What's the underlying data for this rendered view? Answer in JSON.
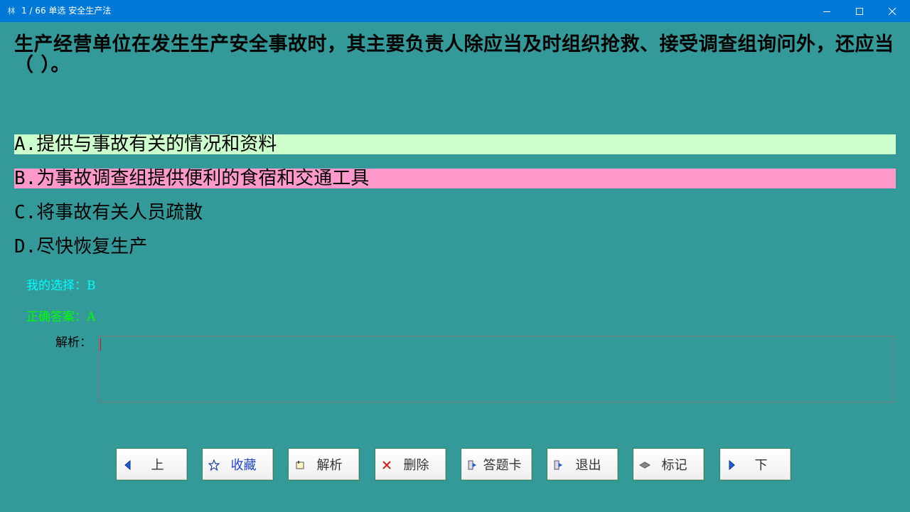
{
  "titlebar": {
    "app_icon": "林",
    "title": "1 / 66   单选  安全生产法"
  },
  "question": {
    "text": "生产经营单位在发生生产安全事故时，其主要负责人除应当及时组织抢救、接受调查组询问外，还应当（      ）。"
  },
  "options": [
    {
      "text": "A.提供与事故有关的情况和资料",
      "state": "correct",
      "highlight": "#ccffcc"
    },
    {
      "text": "B.为事故调查组提供便利的食宿和交通工具",
      "state": "selected-wrong",
      "highlight": "#ff99cc"
    },
    {
      "text": "C.将事故有关人员疏散",
      "state": "none"
    },
    {
      "text": "D.尽快恢复生产",
      "state": "none"
    }
  ],
  "result": {
    "my_choice": "我的选择：B",
    "correct_answer": "正确答案：A",
    "analysis_label": "解析：",
    "analysis_text": ""
  },
  "buttons": {
    "prev": "上",
    "favorite": "收藏",
    "analysis": "解析",
    "delete": "删除",
    "answer_card": "答题卡",
    "exit": "退出",
    "mark": "标记",
    "next": "下"
  },
  "icons": {
    "prev": "triangle-left-icon",
    "favorite": "star-icon",
    "analysis": "note-icon",
    "delete": "x-icon",
    "answer_card": "door-arrow-icon",
    "exit": "door-arrow-icon",
    "mark": "eraser-icon",
    "next": "triangle-right-icon"
  },
  "colors": {
    "background": "#339999",
    "titlebar": "#0078d7",
    "correct_highlight": "#ccffcc",
    "wrong_highlight": "#ff99cc",
    "my_choice_text": "#00ffff",
    "correct_text": "#00ff00"
  }
}
